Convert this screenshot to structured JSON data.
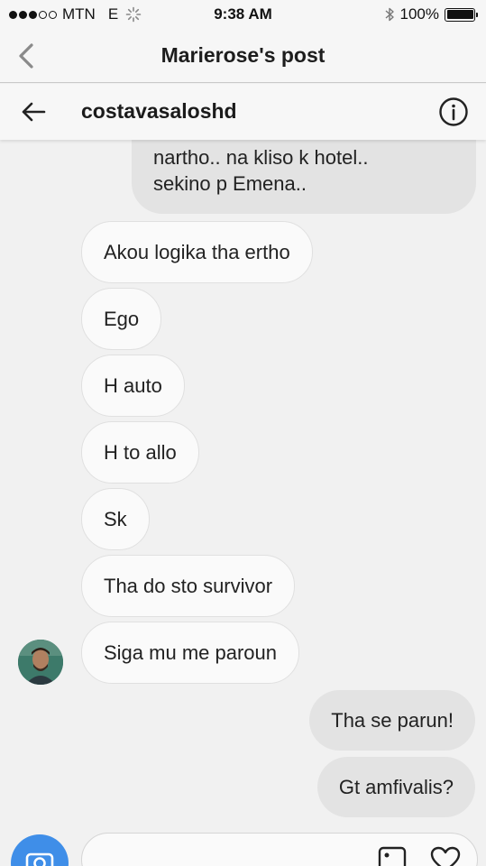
{
  "status_bar": {
    "carrier": "MTN",
    "network": "E",
    "time": "9:38 AM",
    "battery": "100%",
    "battery_level": 1.0
  },
  "nav": {
    "title": "Marierose's post"
  },
  "thread": {
    "username": "costavasaloshd"
  },
  "messages": {
    "out_top": "nartho.. na kliso k hotel..\nsekino p Emena..",
    "in": [
      "Akou logika tha ertho",
      "Ego",
      "H auto",
      "H to allo",
      "Sk",
      "Tha do sto survivor",
      "Siga mu me paroun"
    ],
    "out": [
      "Tha se parun!",
      "Gt amfivalis?"
    ]
  },
  "colors": {
    "incoming_bubble": "#fafafa",
    "outgoing_bubble": "#e3e3e3",
    "camera_button": "#3f8ee8"
  },
  "icons": {
    "nav_back": "chevron-left-icon",
    "thread_back": "arrow-left-icon",
    "info": "info-icon",
    "camera": "camera-icon",
    "gallery": "image-icon",
    "like": "heart-icon"
  }
}
